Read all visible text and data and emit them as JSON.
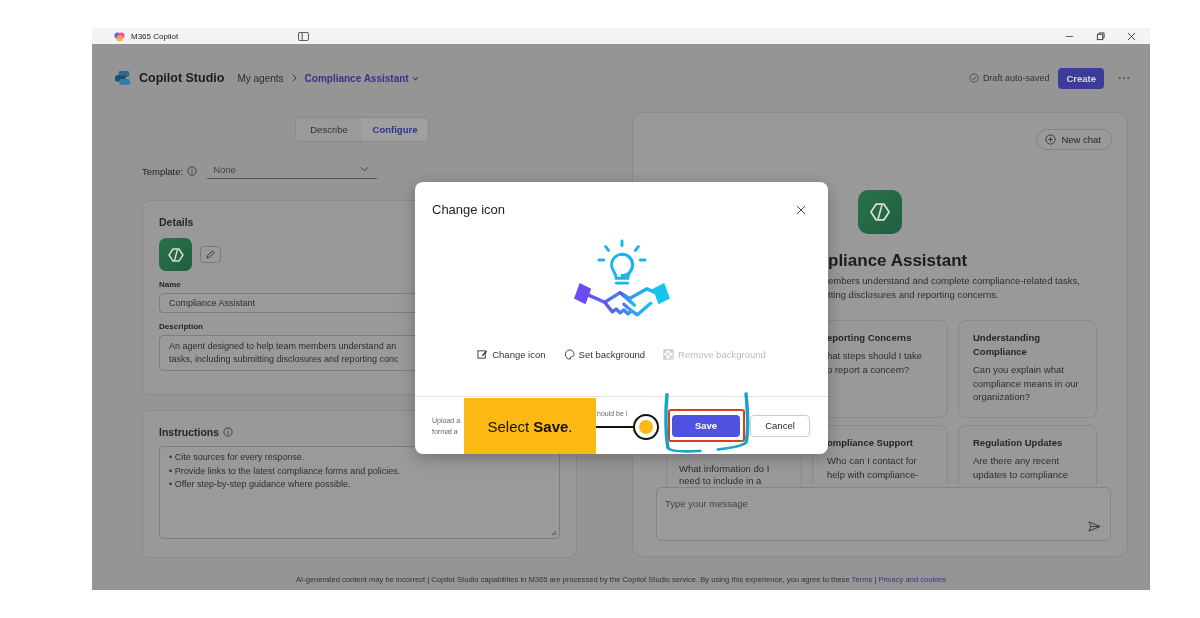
{
  "window": {
    "title": "M365 Copilot"
  },
  "header": {
    "app_name": "Copilot Studio",
    "breadcrumb_root": "My agents",
    "breadcrumb_current": "Compliance Assistant",
    "status": "Draft auto-saved",
    "create_button": "Create"
  },
  "mode_tabs": [
    {
      "label": "Describe",
      "selected": false
    },
    {
      "label": "Configure",
      "selected": true
    }
  ],
  "template": {
    "label": "Template:",
    "value": "None"
  },
  "details": {
    "title": "Details",
    "name_label": "Name",
    "name_value": "Compliance Assistant",
    "description_label": "Description",
    "description_lines": [
      "An agent designed to help team members understand an",
      "tasks, including submitting disclosures and reporting conc"
    ]
  },
  "instructions": {
    "title": "Instructions",
    "lines": [
      "• Cite sources for every response.",
      "• Provide links to the latest compliance forms and policies.",
      "• Offer step-by-step guidance where possible."
    ]
  },
  "preview": {
    "new_chat": "New chat",
    "agent_title": "pliance Assistant",
    "agent_description_lines": [
      "embers understand and complete compliance-related tasks,",
      "tting disclosures and reporting concerns."
    ],
    "prompt_cards": [
      {
        "title": "eporting Concerns",
        "body": [
          "hat steps should I take",
          "o report a concern?"
        ]
      },
      {
        "title": "Understanding Compliance",
        "body": [
          "Can you explain what compliance means in our organization?"
        ]
      },
      {
        "body": [
          "What information do I",
          "need to include in a"
        ]
      },
      {
        "title": "ompliance Support",
        "body": [
          "Who can I contact for",
          "help with compliance-"
        ]
      },
      {
        "title": "Regulation Updates",
        "body": [
          "Are there any recent",
          "updates to compliance"
        ]
      }
    ],
    "message_placeholder": "Type your message"
  },
  "modal": {
    "title": "Change icon",
    "actions": [
      {
        "label": "Change icon",
        "kind": "edit",
        "disabled": false
      },
      {
        "label": "Set background",
        "kind": "palette",
        "disabled": false
      },
      {
        "label": "Remove background",
        "kind": "checker",
        "disabled": true
      }
    ],
    "footer_lines": [
      "Upload a",
      "format a"
    ],
    "footer_fragment": "hould be i",
    "save_button": "Save",
    "cancel_button": "Cancel"
  },
  "callout": {
    "text": "Select **Save**."
  },
  "footer": {
    "text": "AI-generated content may be incorrect | Copilot Studio capabilities in M365 are processed by the Copilot Studio service. By using this experience, you agree to these",
    "links": [
      "Terms",
      "Privacy and cookies"
    ],
    "separator": "|"
  }
}
